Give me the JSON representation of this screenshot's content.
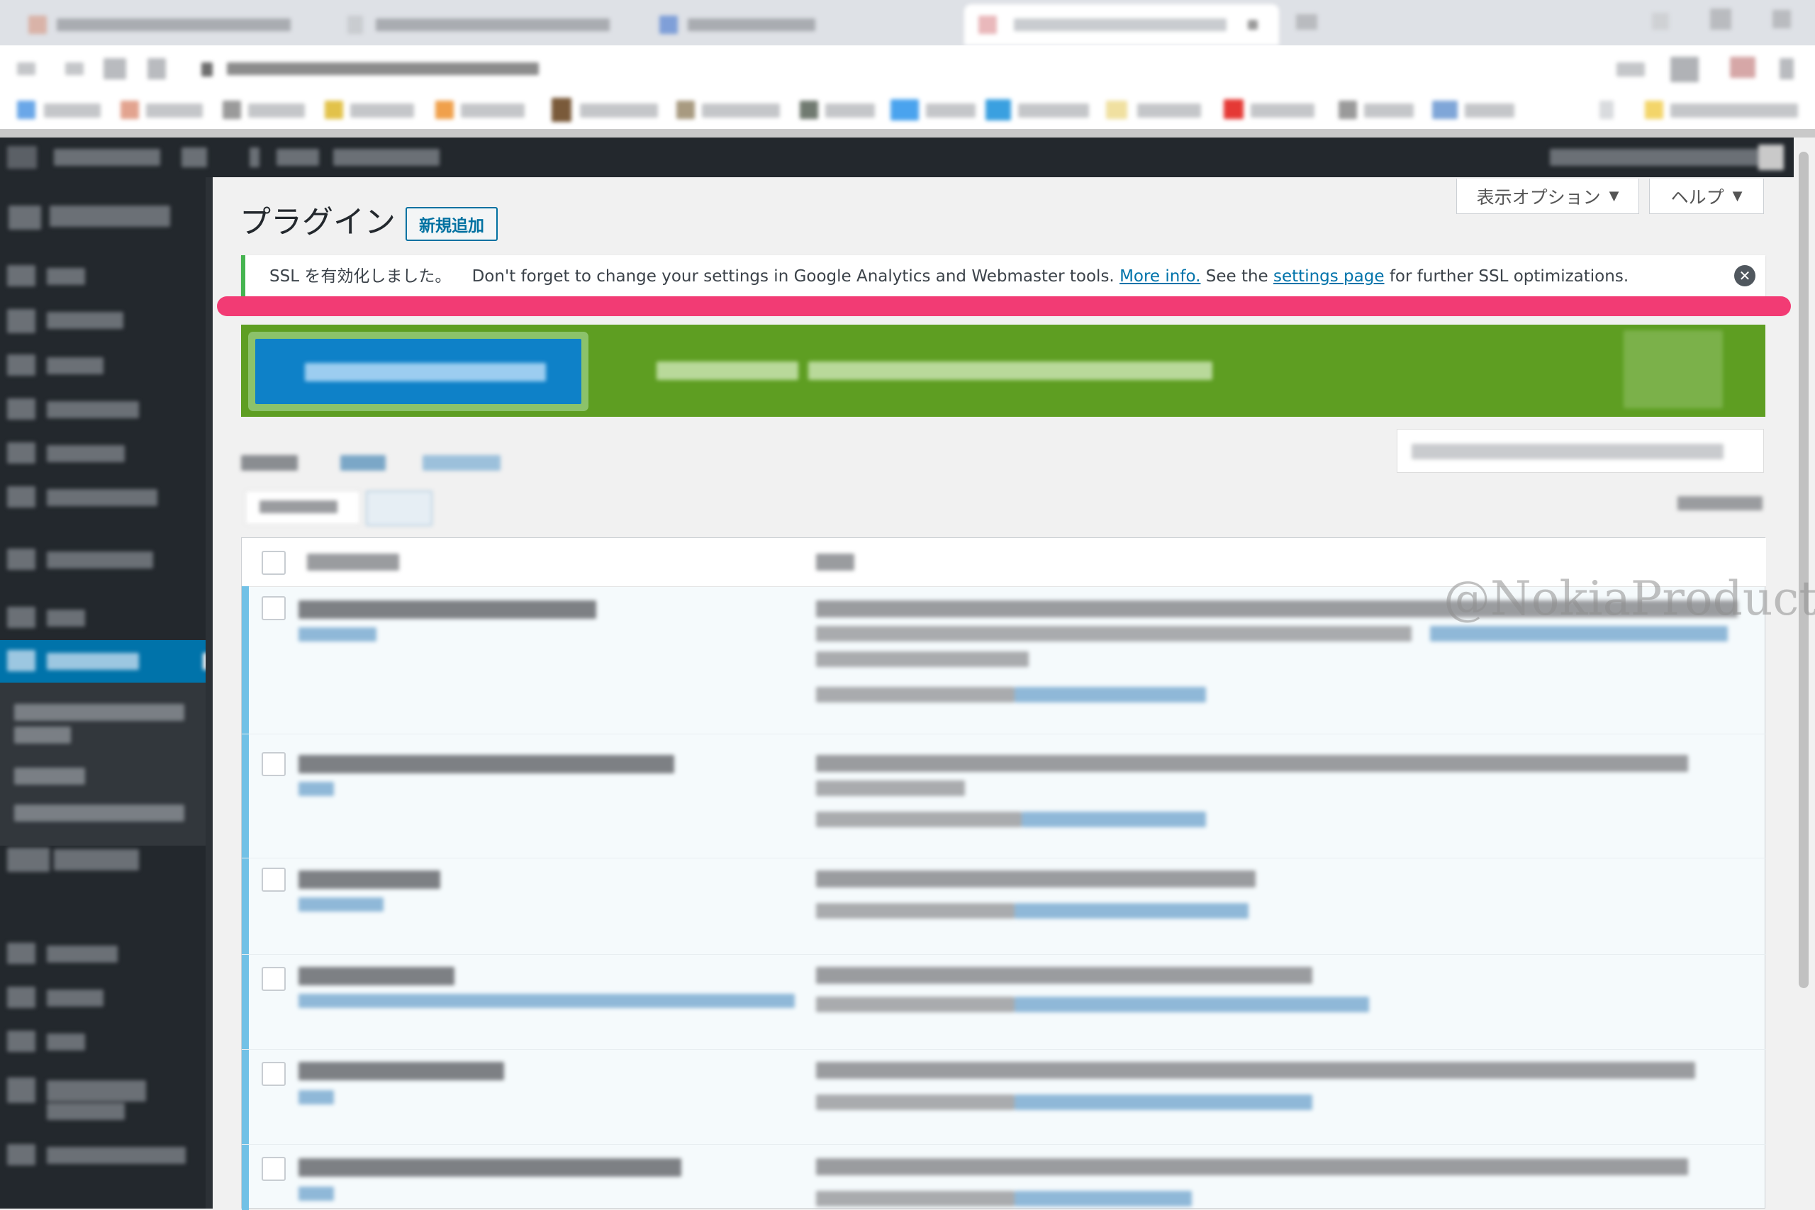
{
  "screen_meta": {
    "screen_options_label": "表示オプション",
    "help_label": "ヘルプ",
    "arrow": "▼"
  },
  "page": {
    "title": "プラグイン",
    "add_new_label": "新規追加"
  },
  "notice": {
    "prefix": "SSL を有効化しました。",
    "text1": "Don't forget to change your settings in Google Analytics and Webmaster tools.",
    "link1": "More info.",
    "text2": "See the",
    "link2": "settings page",
    "text3": "for further SSL optimizations.",
    "dismiss_icon": "✕"
  },
  "watermark": "@NokiaProduction",
  "colors": {
    "admin_bar": "#23282d",
    "active_menu": "#0073aa",
    "notice_border": "#46b450",
    "highlight": "#f23b74",
    "promo": "#5e9e22"
  }
}
